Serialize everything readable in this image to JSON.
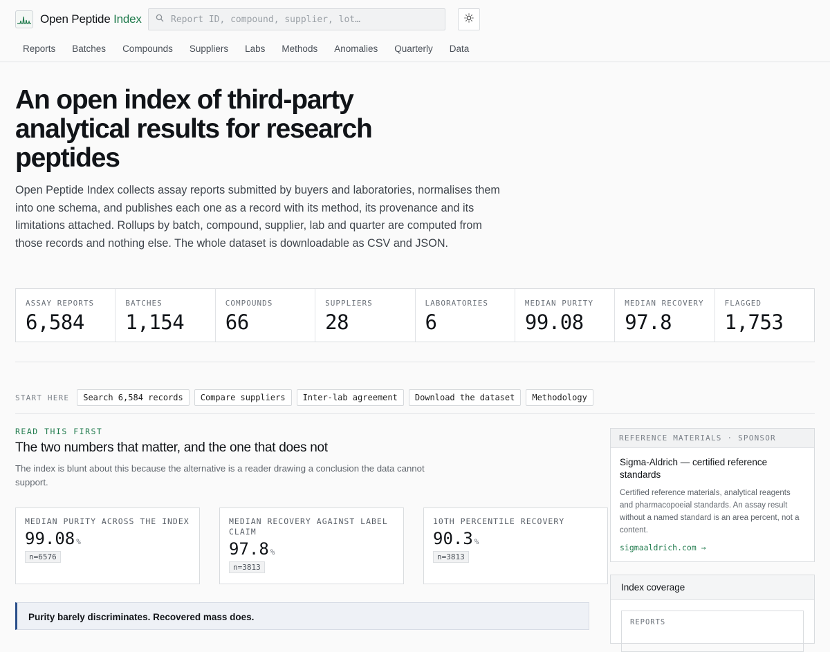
{
  "header": {
    "brand_primary": "Open Peptide",
    "brand_accent": "Index",
    "search_placeholder": "Report ID, compound, supplier, lot…",
    "nav": [
      "Reports",
      "Batches",
      "Compounds",
      "Suppliers",
      "Labs",
      "Methods",
      "Anomalies",
      "Quarterly",
      "Data"
    ]
  },
  "hero": {
    "title": "An open index of third-party analytical results for research peptides",
    "lede": "Open Peptide Index collects assay reports submitted by buyers and laboratories, normalises them into one schema, and publishes each one as a record with its method, its provenance and its limitations attached. Rollups by batch, compound, supplier, lab and quarter are computed from those records and nothing else. The whole dataset is downloadable as CSV and JSON."
  },
  "stats": [
    {
      "label": "ASSAY REPORTS",
      "value": "6,584"
    },
    {
      "label": "BATCHES",
      "value": "1,154"
    },
    {
      "label": "COMPOUNDS",
      "value": "66"
    },
    {
      "label": "SUPPLIERS",
      "value": "28"
    },
    {
      "label": "LABORATORIES",
      "value": "6"
    },
    {
      "label": "MEDIAN PURITY",
      "value": "99.08"
    },
    {
      "label": "MEDIAN RECOVERY",
      "value": "97.8"
    },
    {
      "label": "FLAGGED",
      "value": "1,753"
    }
  ],
  "start_here": {
    "label": "START HERE",
    "chips": [
      "Search 6,584 records",
      "Compare suppliers",
      "Inter-lab agreement",
      "Download the dataset",
      "Methodology"
    ]
  },
  "read_first": {
    "kicker": "READ THIS FIRST",
    "title": "The two numbers that matter, and the one that does not",
    "subtitle": "The index is blunt about this because the alternative is a reader drawing a conclusion the data cannot support.",
    "cards": [
      {
        "label": "MEDIAN PURITY ACROSS THE INDEX",
        "value": "99.08",
        "unit": "%",
        "n": "n=6576"
      },
      {
        "label": "MEDIAN RECOVERY AGAINST LABEL CLAIM",
        "value": "97.8",
        "unit": "%",
        "n": "n=3813"
      },
      {
        "label": "10TH PERCENTILE RECOVERY",
        "value": "90.3",
        "unit": "%",
        "n": "n=3813"
      }
    ],
    "callout": "Purity barely discriminates. Recovered mass does."
  },
  "sponsor": {
    "header": "REFERENCE MATERIALS · SPONSOR",
    "title": "Sigma-Aldrich — certified reference standards",
    "text": "Certified reference materials, analytical reagents and pharmacopoeial standards. An assay result without a named standard is an area percent, not a content.",
    "link": "sigmaaldrich.com →"
  },
  "coverage": {
    "title": "Index coverage",
    "first_label": "REPORTS"
  },
  "colors": {
    "accent": "#1f7a4c",
    "callout_border": "#2a4f8a"
  },
  "icons": {
    "logo": "chromatogram-logo-icon",
    "search": "search-icon",
    "theme": "sun-icon"
  }
}
